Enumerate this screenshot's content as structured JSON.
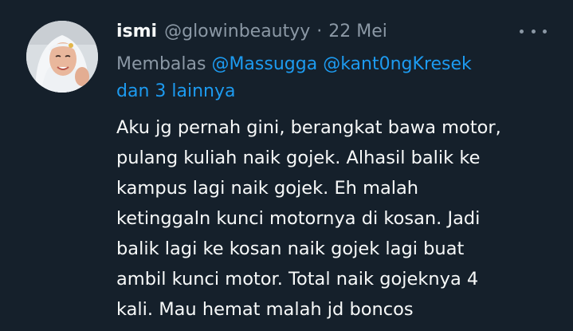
{
  "author": {
    "name": "ismi",
    "handle": "@glowinbeautyy",
    "separator": "·",
    "date": "22 Mei"
  },
  "reply_to": {
    "prefix": "Membalas",
    "mentions": [
      "@Massugga",
      "@kant0ngKresek"
    ],
    "others": "dan 3 lainnya"
  },
  "body_lines": [
    "Aku jg pernah gini, berangkat bawa motor,",
    "pulang kuliah naik gojek. Alhasil balik ke",
    "kampus lagi naik gojek. Eh malah",
    "ketinggaln kunci motornya di kosan. Jadi",
    "balik lagi ke kosan naik gojek lagi buat",
    "ambil kunci motor. Total naik gojeknya 4",
    "kali. Mau hemat malah jd boncos"
  ],
  "icons": {
    "more": "more-horizontal-icon",
    "avatar": "profile-avatar"
  },
  "colors": {
    "background": "#15202b",
    "text_primary": "#f7f9f9",
    "text_secondary": "#8b98a5",
    "link": "#1d9bf0"
  }
}
